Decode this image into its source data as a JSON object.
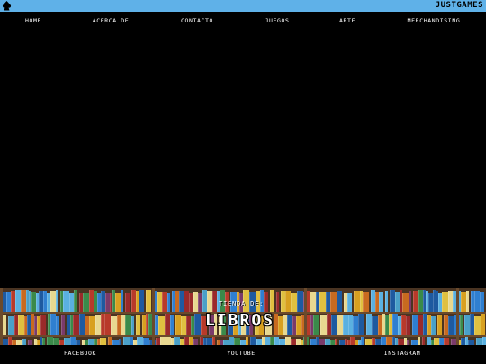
{
  "header": {
    "brand": "JUSTGAMES",
    "logo_icon": "spade-icon",
    "bar_color": "#5fb1e8"
  },
  "nav": {
    "items": [
      {
        "label": "HOME"
      },
      {
        "label": "ACERCA DE"
      },
      {
        "label": "CONTACTO"
      },
      {
        "label": "JUEGOS"
      },
      {
        "label": "ARTE"
      },
      {
        "label": "MERCHANDISING"
      }
    ]
  },
  "banner": {
    "subtitle": "TIENDA DE:",
    "title": "LIBROS",
    "image": "bookshelf-pixel-art"
  },
  "footer": {
    "links": [
      {
        "label": "FACEBOOK"
      },
      {
        "label": "YOUTUBE"
      },
      {
        "label": "INSTAGRAM"
      }
    ]
  }
}
